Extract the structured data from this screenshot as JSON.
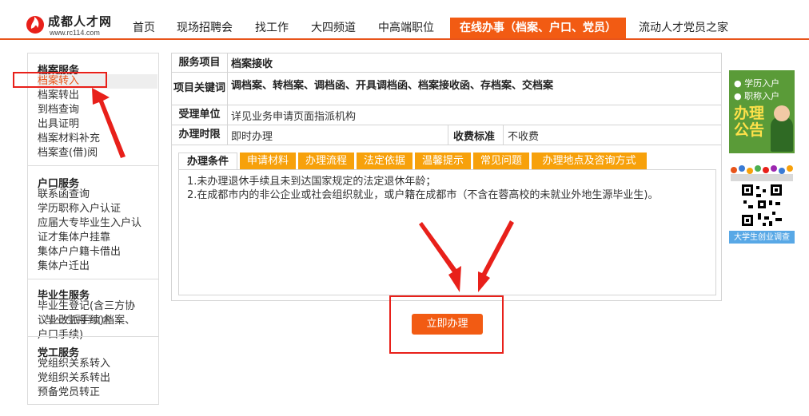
{
  "header": {
    "logo_name": "成都人才网",
    "logo_url": "www.rc114.com",
    "nav": [
      {
        "label": "首页"
      },
      {
        "label": "现场招聘会"
      },
      {
        "label": "找工作"
      },
      {
        "label": "大四频道"
      },
      {
        "label": "中高端职位"
      },
      {
        "label": "在线办事（档案、户口、党员）",
        "active": true
      },
      {
        "label": "流动人才党员之家"
      }
    ]
  },
  "sidebar": {
    "groups": [
      {
        "title": "档案服务",
        "items": [
          "档案转入",
          "档案转出",
          "到档查询",
          "出具证明",
          "档案材料补充",
          "档案查(借)阅"
        ]
      },
      {
        "title": "户口服务",
        "items": [
          "联系函查询",
          "学历职称入户认证",
          "应届大专毕业生入户认",
          "证才集体户挂靠",
          "集体户户籍卡借出",
          "集体户迁出"
        ]
      },
      {
        "title": "毕业生服务",
        "items": [
          "毕业生登记(含三方协",
          "议业改派手续)档案、",
          "户口手续)"
        ],
        "overlap_item": "毕业生报到(含"
      },
      {
        "title": "党工服务",
        "items": [
          "党组织关系转入",
          "党组织关系转出",
          "预备党员转正"
        ]
      }
    ],
    "selected_item": "档案转入"
  },
  "table": {
    "service_label": "服务项目",
    "service_value": "档案接收",
    "keywords_label": "项目关键词",
    "keywords_value": "调档案、转档案、调档函、开具调档函、档案接收函、存档案、交档案",
    "unit_label": "受理单位",
    "unit_value": "详见业务申请页面指派机构",
    "time_label": "办理时限",
    "time_value": "即时办理",
    "fee_label": "收费标准",
    "fee_value": "不收费"
  },
  "tabs": [
    {
      "label": "办理条件",
      "active": true
    },
    {
      "label": "申请材料"
    },
    {
      "label": "办理流程"
    },
    {
      "label": "法定依据"
    },
    {
      "label": "温馨提示"
    },
    {
      "label": "常见问题"
    },
    {
      "label": "办理地点及咨询方式"
    }
  ],
  "conditions": [
    "1.未办理退休手续且未到达国家规定的法定退休年龄；",
    "2.在成都市内的非公企业或社会组织就业，或户籍在成都市（不含在蓉高校的未就业外地生源毕业生)。"
  ],
  "apply_button": "立即办理",
  "banners": {
    "ad1_lines": [
      "● 学历入户",
      "● 职称入户"
    ],
    "ad1_title": "办理公告",
    "ad2_caption": "大学生创业调查"
  },
  "colors": {
    "accent": "#f25b13",
    "tab": "#f7a10b",
    "annotation": "#e8201a"
  }
}
